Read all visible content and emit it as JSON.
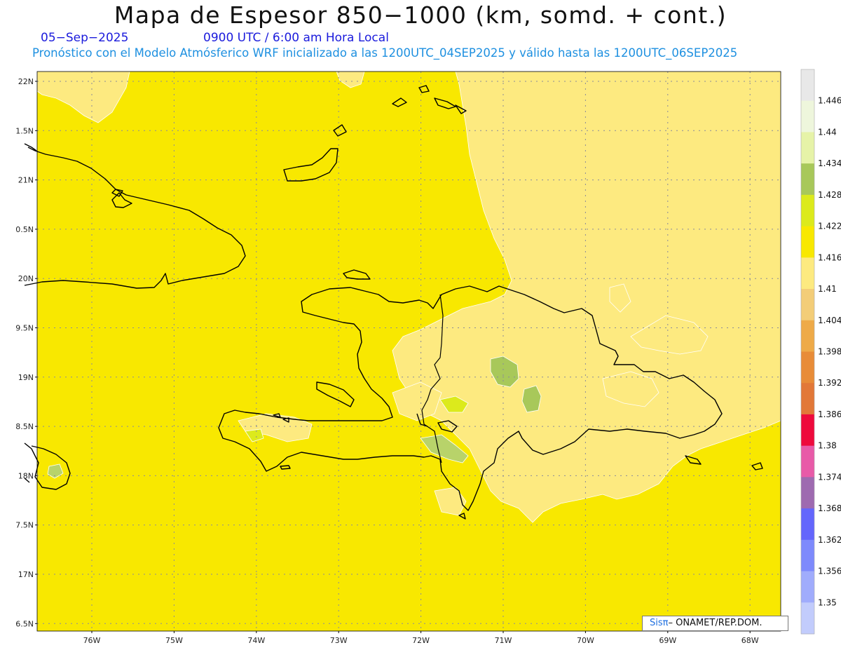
{
  "title": "Mapa de Espesor 850−1000 (km, somd. + cont.)",
  "subtitle": {
    "date": "05−Sep−2025",
    "time": "0900 UTC / 6:00 am Hora Local",
    "forecast": "Pronóstico con el Modelo Atmósferico WRF inicializado a las 1200UTC_04SEP2025 y válido hasta las  1200UTC_06SEP2025"
  },
  "map": {
    "lat_ticks": [
      "22N",
      "1.5N",
      "21N",
      "0.5N",
      "20N",
      "9.5N",
      "19N",
      "8.5N",
      "18N",
      "7.5N",
      "17N",
      "6.5N"
    ],
    "lon_ticks": [
      "76W",
      "75W",
      "74W",
      "73W",
      "72W",
      "71W",
      "70W",
      "69W",
      "68W"
    ],
    "background_color": "#f8e800",
    "light_color": "#fdea80",
    "green_color": "#b8d36a",
    "coast_color": "#000000"
  },
  "colorbar": {
    "levels": [
      "1.446",
      "1.44",
      "1.434",
      "1.428",
      "1.422",
      "1.416",
      "1.41",
      "1.404",
      "1.398",
      "1.392",
      "1.386",
      "1.38",
      "1.374",
      "1.368",
      "1.362",
      "1.356",
      "1.35"
    ],
    "colors": [
      "#e8e8e8",
      "#eef6dc",
      "#e6f3a8",
      "#a8c85a",
      "#dcea1c",
      "#f8e800",
      "#fdea80",
      "#f3cd78",
      "#eeaa48",
      "#e88c38",
      "#e27838",
      "#ee0a3c",
      "#e85aa8",
      "#9e6ab0",
      "#6466fc",
      "#7e8afc",
      "#a0acfc",
      "#c2ccfc"
    ]
  },
  "credit": {
    "sis": "Sisπ",
    "org": "– ONAMET/REP.DOM."
  }
}
